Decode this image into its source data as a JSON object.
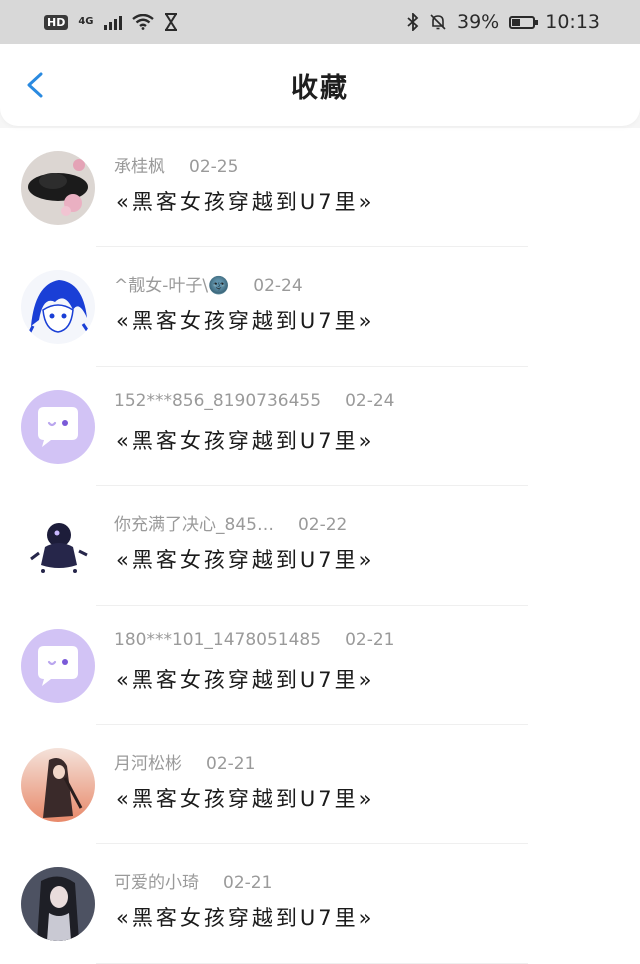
{
  "status_bar": {
    "hd": "HD",
    "network": "4G",
    "battery_percent": "39%",
    "battery_level": 0.39,
    "time": "10:13"
  },
  "header": {
    "title": "收藏"
  },
  "items": [
    {
      "user": "承桂枫",
      "date": "02-25",
      "text": "«黑客女孩穿越到U7里»",
      "avatar": "photo-black-hat-flowers"
    },
    {
      "user": "^靓女-叶子\\🌚",
      "date": "02-24",
      "text": "«黑客女孩穿越到U7里»",
      "avatar": "anime-blue-hair-girl"
    },
    {
      "user": "152***856_8190736455",
      "date": "02-24",
      "text": "«黑客女孩穿越到U7里»",
      "avatar": "default-purple-chat"
    },
    {
      "user": "你充满了决心_845…",
      "date": "02-22",
      "text": "«黑客女孩穿越到U7里»",
      "avatar": "chibi-dark-character"
    },
    {
      "user": "180***101_1478051485",
      "date": "02-21",
      "text": "«黑客女孩穿越到U7里»",
      "avatar": "default-purple-chat"
    },
    {
      "user": "月河松彬",
      "date": "02-21",
      "text": "«黑客女孩穿越到U7里»",
      "avatar": "anime-sunset-girl"
    },
    {
      "user": "可爱的小琦",
      "date": "02-21",
      "text": "«黑客女孩穿越到U7里»",
      "avatar": "anime-dark-hair-girl"
    }
  ]
}
